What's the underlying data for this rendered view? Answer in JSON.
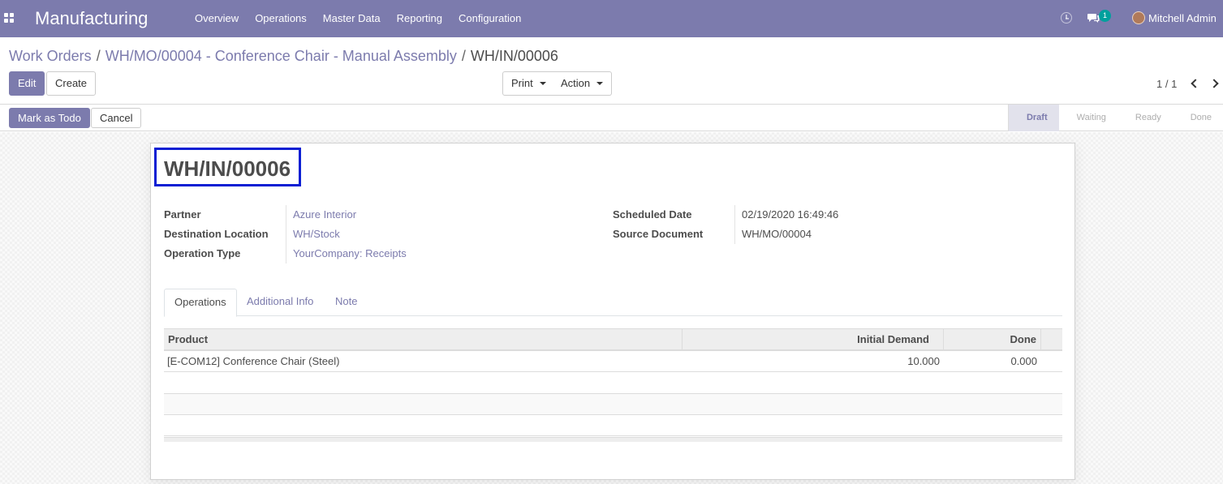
{
  "navbar": {
    "app_name": "Manufacturing",
    "menu": [
      "Overview",
      "Operations",
      "Master Data",
      "Reporting",
      "Configuration"
    ],
    "messages_count": "1",
    "user_name": "Mitchell Admin"
  },
  "breadcrumb": {
    "items": [
      "Work Orders",
      "WH/MO/00004 - Conference Chair - Manual Assembly"
    ],
    "current": "WH/IN/00006"
  },
  "buttons": {
    "edit": "Edit",
    "create": "Create",
    "print": "Print",
    "action": "Action",
    "mark_as_todo": "Mark as Todo",
    "cancel": "Cancel"
  },
  "pager": "1 / 1",
  "status_steps": [
    "Draft",
    "Waiting",
    "Ready",
    "Done"
  ],
  "record": {
    "name": "WH/IN/00006",
    "fields_left": [
      {
        "label": "Partner",
        "value": "Azure Interior"
      },
      {
        "label": "Destination Location",
        "value": "WH/Stock"
      },
      {
        "label": "Operation Type",
        "value": "YourCompany: Receipts"
      }
    ],
    "fields_right": [
      {
        "label": "Scheduled Date",
        "value": "02/19/2020 16:49:46"
      },
      {
        "label": "Source Document",
        "value": "WH/MO/00004"
      }
    ]
  },
  "tabs": [
    "Operations",
    "Additional Info",
    "Note"
  ],
  "table": {
    "headers": [
      "Product",
      "Initial Demand",
      "Done"
    ],
    "rows": [
      {
        "product": "[E-COM12] Conference Chair (Steel)",
        "initial_demand": "10.000",
        "done": "0.000"
      }
    ]
  },
  "colors": {
    "brand": "#7c7bad",
    "highlight_border": "#0a1fd3",
    "badge": "#00a09d"
  }
}
